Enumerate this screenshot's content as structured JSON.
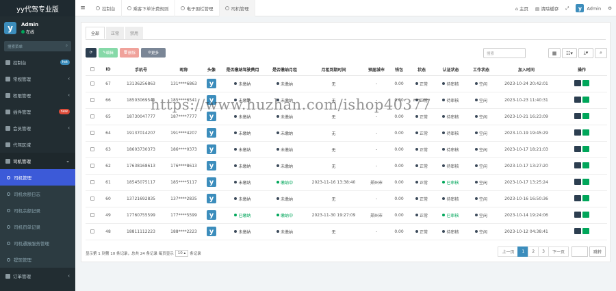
{
  "brand": "yy代驾专业版",
  "user": {
    "name": "Admin",
    "status": "在线"
  },
  "search_placeholder": "搜索菜单",
  "sidebar": [
    {
      "label": "控制台",
      "badge": "hot",
      "badge_color": "#3c8dbc"
    },
    {
      "label": "常规管理",
      "arrow": "‹"
    },
    {
      "label": "权限管理",
      "arrow": "‹"
    },
    {
      "label": "插件管理",
      "badge": "new",
      "badge_color": "#dd4b39"
    },
    {
      "label": "会员管理",
      "arrow": "‹"
    },
    {
      "label": "代驾区域",
      "arrow": ""
    },
    {
      "label": "司机管理",
      "arrow": "⌄"
    }
  ],
  "subnav": [
    "司机管理",
    "司机余额日志",
    "司机余额记录",
    "司机罚单记录",
    "司机通报服务管理",
    "提现管理"
  ],
  "order_nav": "订单管理",
  "toptabs": [
    "控制台",
    "乘客下单计费规则",
    "电子围栏管理",
    "司机管理"
  ],
  "topright": {
    "home": "主页",
    "clear": "清除缓存",
    "admin": "Admin"
  },
  "panel_tabs": [
    "全部",
    "正常",
    "禁用"
  ],
  "buttons": {
    "edit": "编辑",
    "delete": "删除",
    "more": "更多"
  },
  "search_box": "搜索",
  "headers": [
    "ID",
    "手机号",
    "昵称",
    "头像",
    "是否缴纳驾驶费用",
    "是否缴纳月租",
    "月租到期时间",
    "预届城市",
    "钱包",
    "状态",
    "认证状态",
    "工作状态",
    "加入时间",
    "操作"
  ],
  "rows": [
    {
      "id": "67",
      "phone": "13136256863",
      "nick": "131****6863",
      "fee": "未缴纳",
      "rent": "未缴纳",
      "due": "无",
      "city": "-",
      "wallet": "0.00",
      "status": "正常",
      "auth": "待审核",
      "work": "空闲",
      "time": "2023-10-24 20:42:01"
    },
    {
      "id": "66",
      "phone": "18503069541",
      "nick": "185****6541",
      "fee": "未缴纳",
      "rent": "未缴纳",
      "due": "无",
      "city": "-",
      "wallet": "0.00",
      "status": "正常",
      "auth": "待审核",
      "work": "空闲",
      "time": "2023-10-23 11:40:31"
    },
    {
      "id": "65",
      "phone": "18730047777",
      "nick": "187****7777",
      "fee": "未缴纳",
      "rent": "未缴纳",
      "due": "无",
      "city": "-",
      "wallet": "0.00",
      "status": "正常",
      "auth": "待审核",
      "work": "空闲",
      "time": "2023-10-21 16:23:09"
    },
    {
      "id": "64",
      "phone": "19137014207",
      "nick": "191****4207",
      "fee": "未缴纳",
      "rent": "未缴纳",
      "due": "无",
      "city": "-",
      "wallet": "0.00",
      "status": "正常",
      "auth": "待审核",
      "work": "空闲",
      "time": "2023-10-19 19:45:29"
    },
    {
      "id": "63",
      "phone": "18603730373",
      "nick": "186****0373",
      "fee": "未缴纳",
      "rent": "未缴纳",
      "due": "无",
      "city": "-",
      "wallet": "0.00",
      "status": "正常",
      "auth": "待审核",
      "work": "空闲",
      "time": "2023-10-17 18:21:03"
    },
    {
      "id": "62",
      "phone": "17638168613",
      "nick": "176****8613",
      "fee": "未缴纳",
      "rent": "未缴纳",
      "due": "无",
      "city": "-",
      "wallet": "0.00",
      "status": "正常",
      "auth": "待审核",
      "work": "空闲",
      "time": "2023-10-17 13:27:20"
    },
    {
      "id": "61",
      "phone": "18545075117",
      "nick": "185****5117",
      "fee": "未缴纳",
      "rent": "缴纳中",
      "rent_ok": true,
      "due": "2023-11-16 13:38:40",
      "city": "郑州市",
      "wallet": "0.00",
      "status": "正常",
      "auth": "已审核",
      "auth_ok": true,
      "work": "空闲",
      "time": "2023-10-17 13:25:24"
    },
    {
      "id": "60",
      "phone": "13721692835",
      "nick": "137****2835",
      "fee": "未缴纳",
      "rent": "未缴纳",
      "due": "无",
      "city": "-",
      "wallet": "0.00",
      "status": "正常",
      "auth": "待审核",
      "work": "空闲",
      "time": "2023-10-16 16:50:36"
    },
    {
      "id": "49",
      "phone": "17760755599",
      "nick": "177****5599",
      "fee": "已缴纳",
      "fee_ok": true,
      "rent": "缴纳中",
      "rent_ok": true,
      "due": "2023-11-30 19:27:09",
      "city": "郑州市",
      "wallet": "0.00",
      "status": "正常",
      "auth": "已审核",
      "auth_ok": true,
      "work": "空闲",
      "time": "2023-10-14 19:24:06"
    },
    {
      "id": "48",
      "phone": "18811112223",
      "nick": "188****2223",
      "fee": "未缴纳",
      "rent": "未缴纳",
      "due": "无",
      "city": "-",
      "wallet": "0.00",
      "status": "正常",
      "auth": "待审核",
      "work": "空闲",
      "time": "2023-10-12 04:38:41"
    }
  ],
  "footer": {
    "text1": "显示第 1 到第 10 条记录，总共 24 条记录 每页显示",
    "per_page": "10",
    "text2": "条记录"
  },
  "pager": {
    "prev": "上一页",
    "pages": [
      "1",
      "2",
      "3"
    ],
    "next": "下一页",
    "go": "跳转"
  },
  "watermark": "https://www.huzhan.com/ishop40377",
  "colors": {
    "green": "#00a65a",
    "dark": "#3c4a5a",
    "blue": "#3c8dbc",
    "active_nav": "#3c5ad8"
  }
}
